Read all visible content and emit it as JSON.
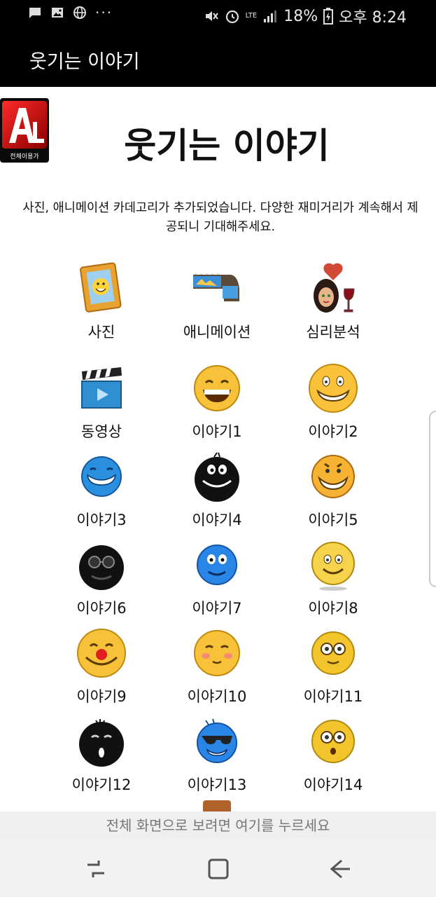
{
  "status_bar": {
    "battery": "18%",
    "time": "오후 8:24",
    "lte_label": "LTE",
    "more_dots": "···"
  },
  "app_bar": {
    "title": "웃기는 이야기"
  },
  "logo": {
    "text": "전체이용가"
  },
  "page": {
    "title": "웃기는 이야기",
    "notice": "사진, 애니메이션 카데고리가 추가되었습니다. 다양한 재미거리가 계속해서 제공되니 기대해주세요."
  },
  "items": [
    {
      "label": "사진",
      "icon": "picture-frame-icon"
    },
    {
      "label": "애니메이션",
      "icon": "film-strip-icon"
    },
    {
      "label": "심리분석",
      "icon": "woman-wine-icon"
    },
    {
      "label": "동영상",
      "icon": "clapperboard-icon"
    },
    {
      "label": "이야기1",
      "icon": "laughing-smiley-icon"
    },
    {
      "label": "이야기2",
      "icon": "grinning-smiley-icon"
    },
    {
      "label": "이야기3",
      "icon": "blue-grin-smiley-icon"
    },
    {
      "label": "이야기4",
      "icon": "black-grin-smiley-icon"
    },
    {
      "label": "이야기5",
      "icon": "big-grin-smiley-icon"
    },
    {
      "label": "이야기6",
      "icon": "sunglasses-black-smiley-icon"
    },
    {
      "label": "이야기7",
      "icon": "blue-smiley-icon"
    },
    {
      "label": "이야기8",
      "icon": "happy-smiley-icon"
    },
    {
      "label": "이야기9",
      "icon": "clown-smiley-icon"
    },
    {
      "label": "이야기10",
      "icon": "blushing-smiley-icon"
    },
    {
      "label": "이야기11",
      "icon": "wide-eyed-smiley-icon"
    },
    {
      "label": "이야기12",
      "icon": "black-surprised-smiley-icon"
    },
    {
      "label": "이야기13",
      "icon": "blue-sunglasses-smiley-icon"
    },
    {
      "label": "이야기14",
      "icon": "surprised-smiley-icon"
    }
  ],
  "banner": {
    "text": "전체 화면으로 보려면 여기를 누르세요"
  },
  "nav": {
    "recent_icon": "recent-apps-icon",
    "home_icon": "home-icon",
    "back_icon": "back-icon"
  }
}
